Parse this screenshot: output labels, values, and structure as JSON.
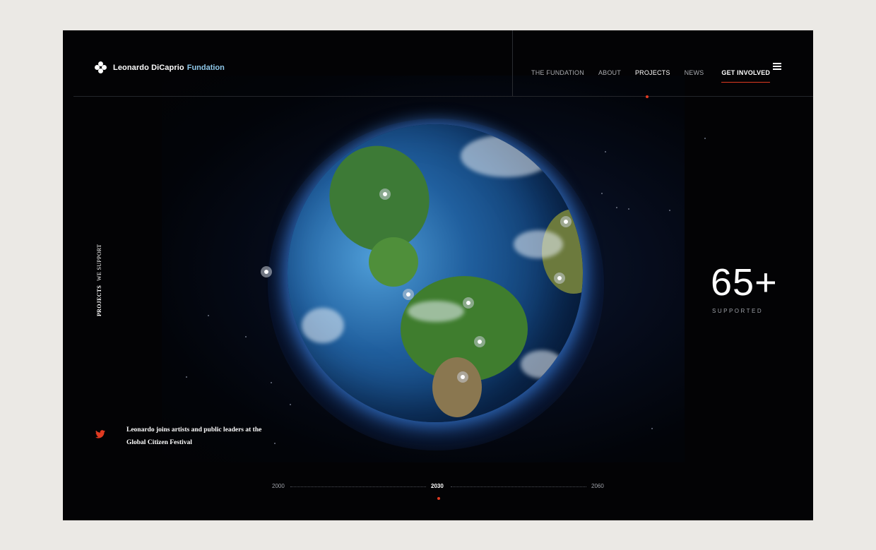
{
  "brand": {
    "name": "Leonardo DiCaprio",
    "accent": "Fundation",
    "logo_icon": "diamond-cluster-logo"
  },
  "nav": {
    "items": [
      {
        "label": "THE FUNDATION",
        "active": false
      },
      {
        "label": "ABOUT",
        "active": false
      },
      {
        "label": "PROJECTS",
        "active": true
      }
    ],
    "news": "NEWS",
    "cta": "GET INVOLVED",
    "menu_icon": "hamburger-icon"
  },
  "side_label": {
    "bold": "PROJECTS",
    "regular": "WE SUPPORT"
  },
  "stat": {
    "value": "65+",
    "label": "SUPPORTED"
  },
  "news": {
    "icon": "twitter-icon",
    "text": "Leonardo joins artists and public leaders at the Global Citizen Festival"
  },
  "timeline": {
    "years": [
      "2000",
      "2030",
      "2060"
    ],
    "current": "2030"
  },
  "colors": {
    "accent_red": "#e03a21",
    "brand_blue": "#8fc8ea",
    "background": "#030305",
    "outer": "#ebe9e5"
  }
}
